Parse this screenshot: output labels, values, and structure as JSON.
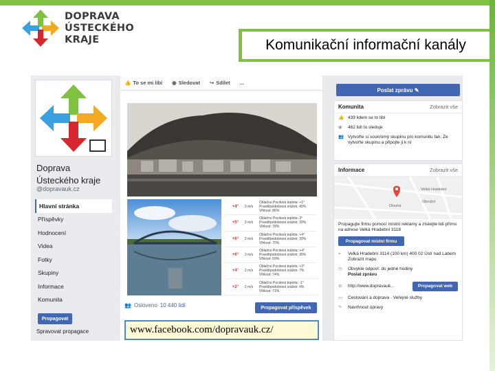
{
  "slide": {
    "title": "Komunikační informační kanály",
    "logo_lines": [
      "DOPRAVA",
      "ÚSTECKÉHO",
      "KRAJE"
    ],
    "url": "www.facebook.com/dopravauk.cz/"
  },
  "facebook": {
    "page_name": "Doprava Ústeckého kraje",
    "handle": "@dopravauk.cz",
    "nav": [
      "Hlavní stránka",
      "Příspěvky",
      "Hodnocení",
      "Videa",
      "Fotky",
      "Skupiny",
      "Informace",
      "Komunita"
    ],
    "promote_label": "Propagovat",
    "manage_label": "Spravovat propagace",
    "actions": [
      "To se mi líbí",
      "Sledovat",
      "Sdílet",
      "..."
    ],
    "weather_rows": [
      {
        "delta": "+4°",
        "wind": "3 m/s",
        "desc": "Oblačno Pocitová teplota: +1° Pravděpodobnost srážek: 40% Vlhkost: 86%"
      },
      {
        "delta": "+5°",
        "wind": "3 m/s",
        "desc": "Oblačno Pocitová teplota: 3° Pravděpodobnost srážek: 30% Vlhkost: 78%"
      },
      {
        "delta": "+6°",
        "wind": "3 m/s",
        "desc": "Oblačno Pocitová teplota: +4° Pravděpodobnost srážek: 30% Vlhkost: 70%"
      },
      {
        "delta": "+6°",
        "wind": "3 m/s",
        "desc": "Oblačno Pocitová teplota: +4° Pravděpodobnost srážek: 30% Vlhkost: 69%"
      },
      {
        "delta": "+4°",
        "wind": "2 m/s",
        "desc": "Oblačno Pocitová teplota: +2° Pravděpodobnost srážek: 7% Vlhkost: 74%"
      },
      {
        "delta": "+2°",
        "wind": "2 m/s",
        "desc": "Oblačno Pocitová teplota: -1° Pravděpodobnost srážek: 4% Vlhkost: 71%"
      }
    ],
    "reached_prefix": "Osloveno",
    "reached_count": "10 440 lidí",
    "promote_post_label": "Propagovat příspěvek",
    "send_message_label": "Poslat zprávu",
    "community": {
      "title": "Komunita",
      "see_all": "Zobrazit vše",
      "rows": [
        "439 lidem se to líbí",
        "462 lidí to sleduje",
        "Vytvořte si soukromý skupinu pro komunitu fan. Ze vytvořte skupinu a připojte ji k ní"
      ]
    },
    "info": {
      "title": "Informace",
      "see_all": "Zobrazit vše",
      "map_labels": [
        "Velká Hradební",
        "Dlouhá",
        "Okružní"
      ],
      "promo_text": "Propagujte firmu pomocí místní reklamy a získejte lidi přímo na adrese Velká Hradební 3118",
      "promote_firm_label": "Propagovat místní firmu",
      "address": "Velká Hradební 3114 (100 km) 400 02 Ústí nad Labem",
      "show_map": "Zobrazit mapu",
      "response": "Obvykle odpoví: do jedné hodiny",
      "send_message": "Poslat zprávu",
      "website": "http://www.dopravauk...",
      "promote_web_label": "Propagovat web",
      "category": "Cestování a doprava · Veřejné služby",
      "suggest": "Navrhnout úpravy"
    }
  }
}
